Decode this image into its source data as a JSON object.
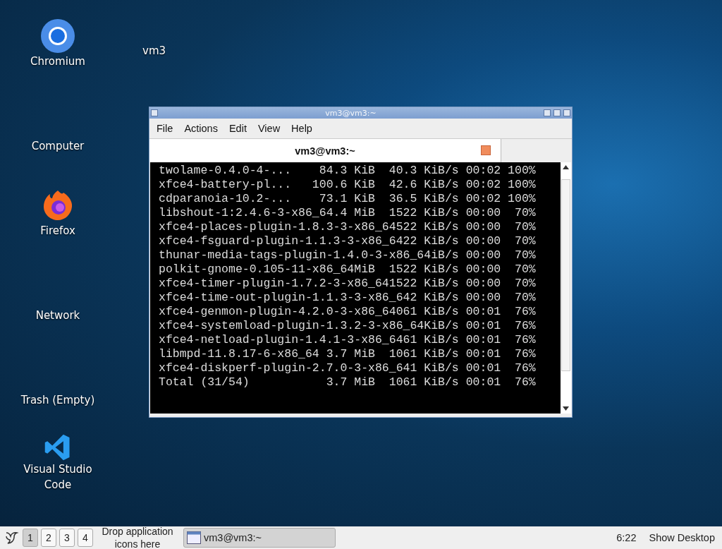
{
  "desktop_icons": [
    {
      "kind": "chromium",
      "label": "Chromium"
    },
    {
      "kind": "none",
      "label": "Computer"
    },
    {
      "kind": "firefox",
      "label": "Firefox"
    },
    {
      "kind": "none",
      "label": "Network"
    },
    {
      "kind": "none",
      "label": "Trash (Empty)"
    },
    {
      "kind": "vscode",
      "label": "Visual Studio Code"
    }
  ],
  "desktop_label": "vm3",
  "window": {
    "title": "vm3@vm3:~",
    "menu": [
      "File",
      "Actions",
      "Edit",
      "View",
      "Help"
    ],
    "tab": {
      "label": "vm3@vm3:~",
      "selected": true
    },
    "terminal_lines": [
      "twolame-0.4.0-4-...    84.3 KiB  40.3 KiB/s 00:02 100%",
      "xfce4-battery-pl...   100.6 KiB  42.6 KiB/s 00:02 100%",
      "cdparanoia-10.2-...    73.1 KiB  36.5 KiB/s 00:02 100%",
      "libshout-1:2.4.6-3-x86_64.4 MiB  1522 KiB/s 00:00  70%",
      "xfce4-places-plugin-1.8.3-3-x86_64522 KiB/s 00:00  70%",
      "xfce4-fsguard-plugin-1.1.3-3-x86_6422 KiB/s 00:00  70%",
      "thunar-media-tags-plugin-1.4.0-3-x86_64iB/s 00:00  70%",
      "polkit-gnome-0.105-11-x86_64MiB  1522 KiB/s 00:00  70%",
      "xfce4-timer-plugin-1.7.2-3-x86_641522 KiB/s 00:00  70%",
      "xfce4-time-out-plugin-1.1.3-3-x86_642 KiB/s 00:00  70%",
      "xfce4-genmon-plugin-4.2.0-3-x86_64061 KiB/s 00:01  76%",
      "xfce4-systemload-plugin-1.3.2-3-x86_64KiB/s 00:01  76%",
      "xfce4-netload-plugin-1.4.1-3-x86_6461 KiB/s 00:01  76%",
      "libmpd-11.8.17-6-x86_64 3.7 MiB  1061 KiB/s 00:01  76%",
      "xfce4-diskperf-plugin-2.7.0-3-x86_641 KiB/s 00:01  76%",
      "Total (31/54)           3.7 MiB  1061 KiB/s 00:01  76%"
    ]
  },
  "taskbar": {
    "workspaces": [
      {
        "label": "1",
        "selected": true
      },
      {
        "label": "2",
        "selected": false
      },
      {
        "label": "3",
        "selected": false
      },
      {
        "label": "4",
        "selected": false
      }
    ],
    "launcher_hint": "Drop application icons here",
    "task": "vm3@vm3:~",
    "clock": "6:22",
    "show_desktop": "Show Desktop"
  }
}
